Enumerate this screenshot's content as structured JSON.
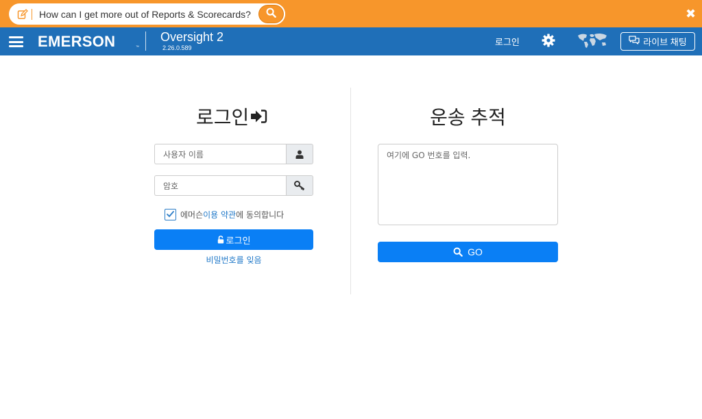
{
  "helpbar": {
    "question": "How can I get more out of Reports & Scorecards?",
    "close_symbol": "✖",
    "accent": "#f7962b"
  },
  "nav": {
    "brand": "EMERSON",
    "brand_tm": "™",
    "product": "Oversight 2",
    "version": "2.26.0.589",
    "login_link": "로그인",
    "chat_label": "라이브 채팅",
    "bg": "#1f6fb8"
  },
  "login": {
    "title": "로그인",
    "username_placeholder": "사용자 이름",
    "password_placeholder": "암호",
    "terms_prefix": "에머슨 ",
    "terms_link": "이용 약관",
    "terms_suffix": "에 동의합니다",
    "terms_checked": true,
    "button_label": "로그인",
    "forgot_link": "비밀번호를 잊음"
  },
  "tracking": {
    "title": "운송 추적",
    "textarea_placeholder": "여기에 GO 번호를 입력.",
    "button_label": "GO"
  },
  "icons": [
    "edit-icon",
    "search-icon",
    "close-icon",
    "menu-icon",
    "gear-icon",
    "world-map-icon",
    "chat-icon",
    "sign-in-icon",
    "user-icon",
    "key-icon",
    "check-icon",
    "unlock-icon"
  ]
}
